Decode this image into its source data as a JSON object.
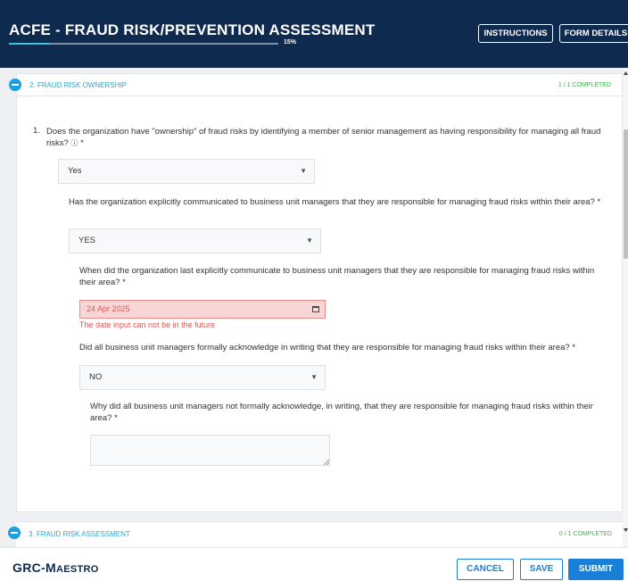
{
  "header": {
    "title": "ACFE - FRAUD RISK/PREVENTION ASSESSMENT",
    "progress_label": "15%",
    "progress_fraction": 0.15,
    "instructions_label": "INSTRUCTIONS",
    "form_details_label": "FORM DETAILS"
  },
  "section2": {
    "title": "2. FRAUD RISK OWNERSHIP",
    "count": "1 / 1 COMPLETED",
    "q1": {
      "number": "1.",
      "text": "Does the organization have \"ownership\" of fraud risks by identifying a member of senior management as having responsibility for managing all fraud risks?",
      "info_icon": "ⓘ",
      "required_mark": "*",
      "answer": "Yes"
    },
    "q1a": {
      "text": "Has the organization explicitly communicated to business unit managers that they are responsible for managing fraud risks within their area?",
      "required_mark": "*",
      "answer": "YES"
    },
    "q1a1": {
      "text": "When did the organization last explicitly communicate to business unit managers that they are responsible for managing fraud risks within their area?",
      "required_mark": "*",
      "date_value": "24 Apr 2025",
      "error": "The date input can not be in the future"
    },
    "q1a2": {
      "text": "Did all business unit managers formally acknowledge in writing that they are responsible for managing fraud risks within their area?",
      "required_mark": "*",
      "answer": "NO"
    },
    "q1a2a": {
      "text": "Why did all business unit managers not formally acknowledge, in writing, that they are responsible for managing fraud risks within their area?",
      "required_mark": "*",
      "answer": ""
    }
  },
  "section3": {
    "title": "3. FRAUD RISK ASSESSMENT",
    "count": "0 / 1 COMPLETED"
  },
  "footer": {
    "logo_prefix": "GRC-",
    "logo_initial": "M",
    "logo_rest": "AESTRO",
    "cancel_label": "CANCEL",
    "save_label": "SAVE",
    "submit_label": "SUBMIT"
  },
  "colors": {
    "header_bg": "#0e2a4e",
    "accent": "#1a9fe0",
    "success": "#3bb34a",
    "error": "#e05555"
  }
}
